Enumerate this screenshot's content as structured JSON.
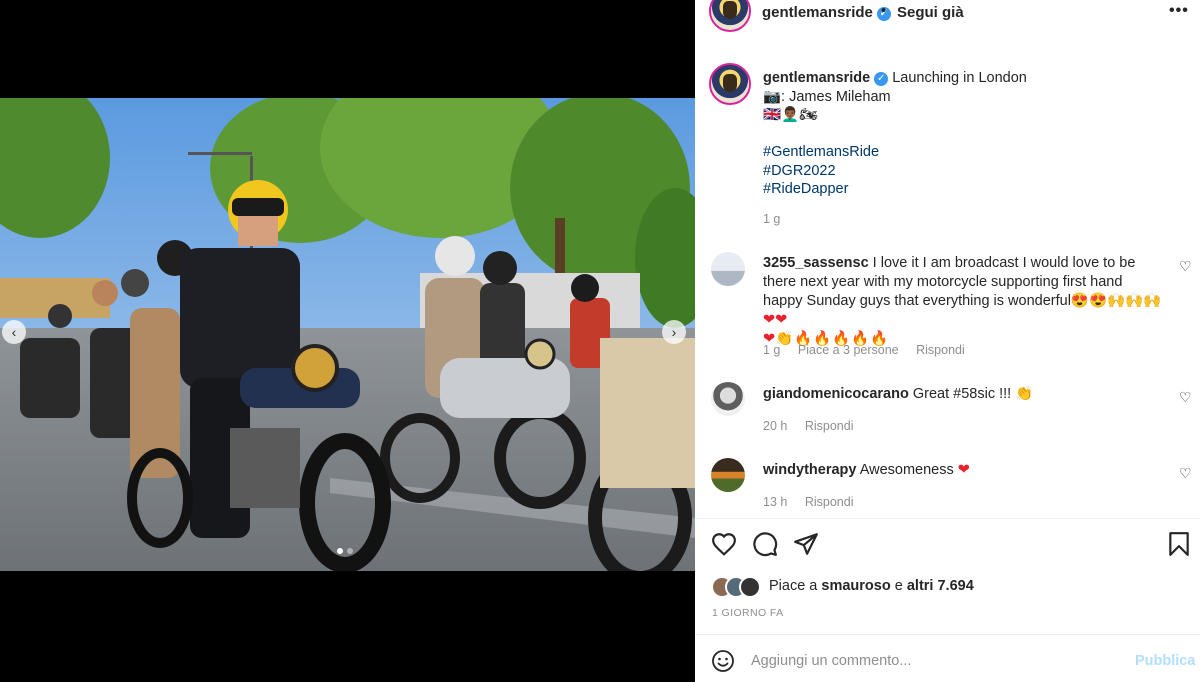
{
  "post": {
    "username": "gentlemansride",
    "follow_status": "Segui già",
    "separator": "•",
    "more": "•••"
  },
  "caption": {
    "username": "gentlemansride",
    "text": "Launching in London",
    "credit": "📷: James Mileham",
    "emojis": "🇬🇧👨🏾‍🦱🏍",
    "hashtags": [
      "#GentlemansRide",
      "#DGR2022",
      "#RideDapper"
    ],
    "time": "1 g"
  },
  "comments": [
    {
      "username": "3255_sassensc",
      "text": "I love it I am broadcast I would love to be there next year with my motorcycle supporting first hand happy Sunday guys that everything is wonderful",
      "emojis_inline": "😍😍🙌🙌🙌",
      "emojis_red": "❤❤",
      "emojis_line2_red": "❤",
      "emojis_line2": "👏🔥🔥🔥🔥🔥",
      "time": "1 g",
      "likes": "Piace a 3 persone",
      "reply": "Rispondi"
    },
    {
      "username": "giandomenicocarano",
      "text": "Great #58sic !!! 👏",
      "time": "20 h",
      "reply": "Rispondi"
    },
    {
      "username": "windytherapy",
      "text": "Awesomeness",
      "emoji_red": "❤",
      "time": "13 h",
      "reply": "Rispondi"
    }
  ],
  "likes": {
    "prefix": "Piace a",
    "user": "smauroso",
    "conj": "e",
    "others": "altri 7.694"
  },
  "date": "1 GIORNO FA",
  "comment_box": {
    "placeholder": "Aggiungi un commento...",
    "publish": "Pubblica"
  },
  "icons": {
    "like": "heart-outline",
    "comment": "speech-bubble",
    "share": "paper-plane",
    "save": "bookmark",
    "emoji": "smiley-face",
    "verified": "checkmark-badge"
  },
  "carousel": {
    "total_slides": 2,
    "active_slide": 1
  },
  "colors": {
    "hashtag": "#00376b",
    "verified": "#3897f0",
    "publish_disabled": "#b2dffc",
    "heart_red": "#e8212e",
    "muted": "#8e8e8e"
  }
}
